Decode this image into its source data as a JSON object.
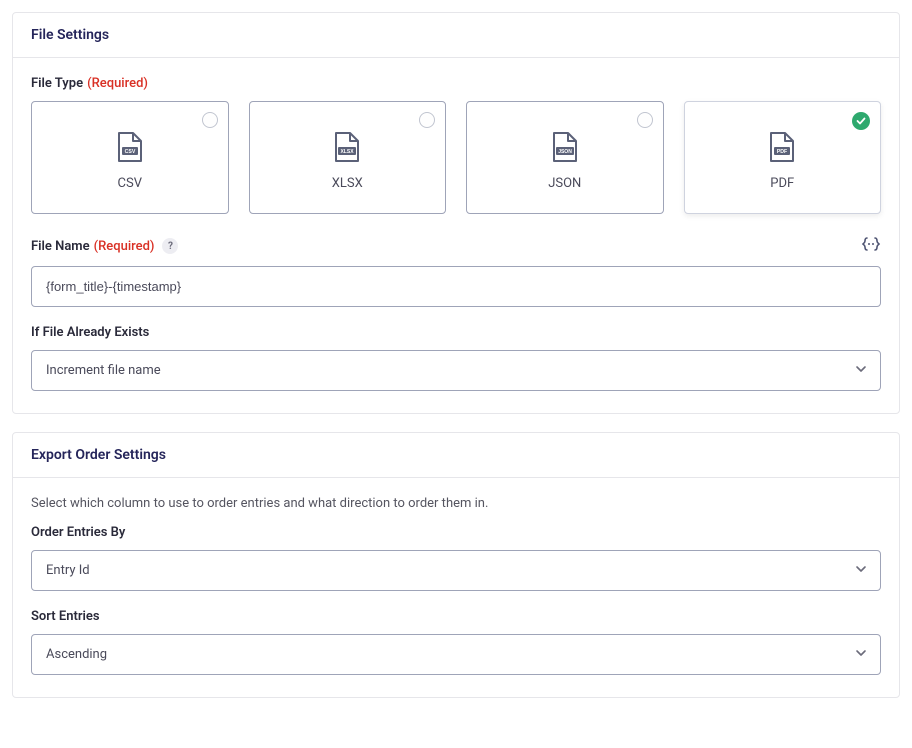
{
  "fileSettings": {
    "title": "File Settings",
    "fileType": {
      "label": "File Type",
      "requiredText": "(Required)",
      "options": [
        {
          "label": "CSV",
          "iconTag": "csv",
          "selected": false
        },
        {
          "label": "XLSX",
          "iconTag": "xlsx",
          "selected": false
        },
        {
          "label": "JSON",
          "iconTag": "json",
          "selected": false
        },
        {
          "label": "PDF",
          "iconTag": "pdf",
          "selected": true
        }
      ]
    },
    "fileName": {
      "label": "File Name",
      "requiredText": "(Required)",
      "helpGlyph": "?",
      "value": "{form_title}-{timestamp}"
    },
    "ifExists": {
      "label": "If File Already Exists",
      "value": "Increment file name"
    }
  },
  "exportOrder": {
    "title": "Export Order Settings",
    "description": "Select which column to use to order entries and what direction to order them in.",
    "orderBy": {
      "label": "Order Entries By",
      "value": "Entry Id"
    },
    "sort": {
      "label": "Sort Entries",
      "value": "Ascending"
    }
  },
  "colors": {
    "accentGreen": "#2ea96e",
    "danger": "#d93025",
    "iconFill": "#5b6178"
  }
}
